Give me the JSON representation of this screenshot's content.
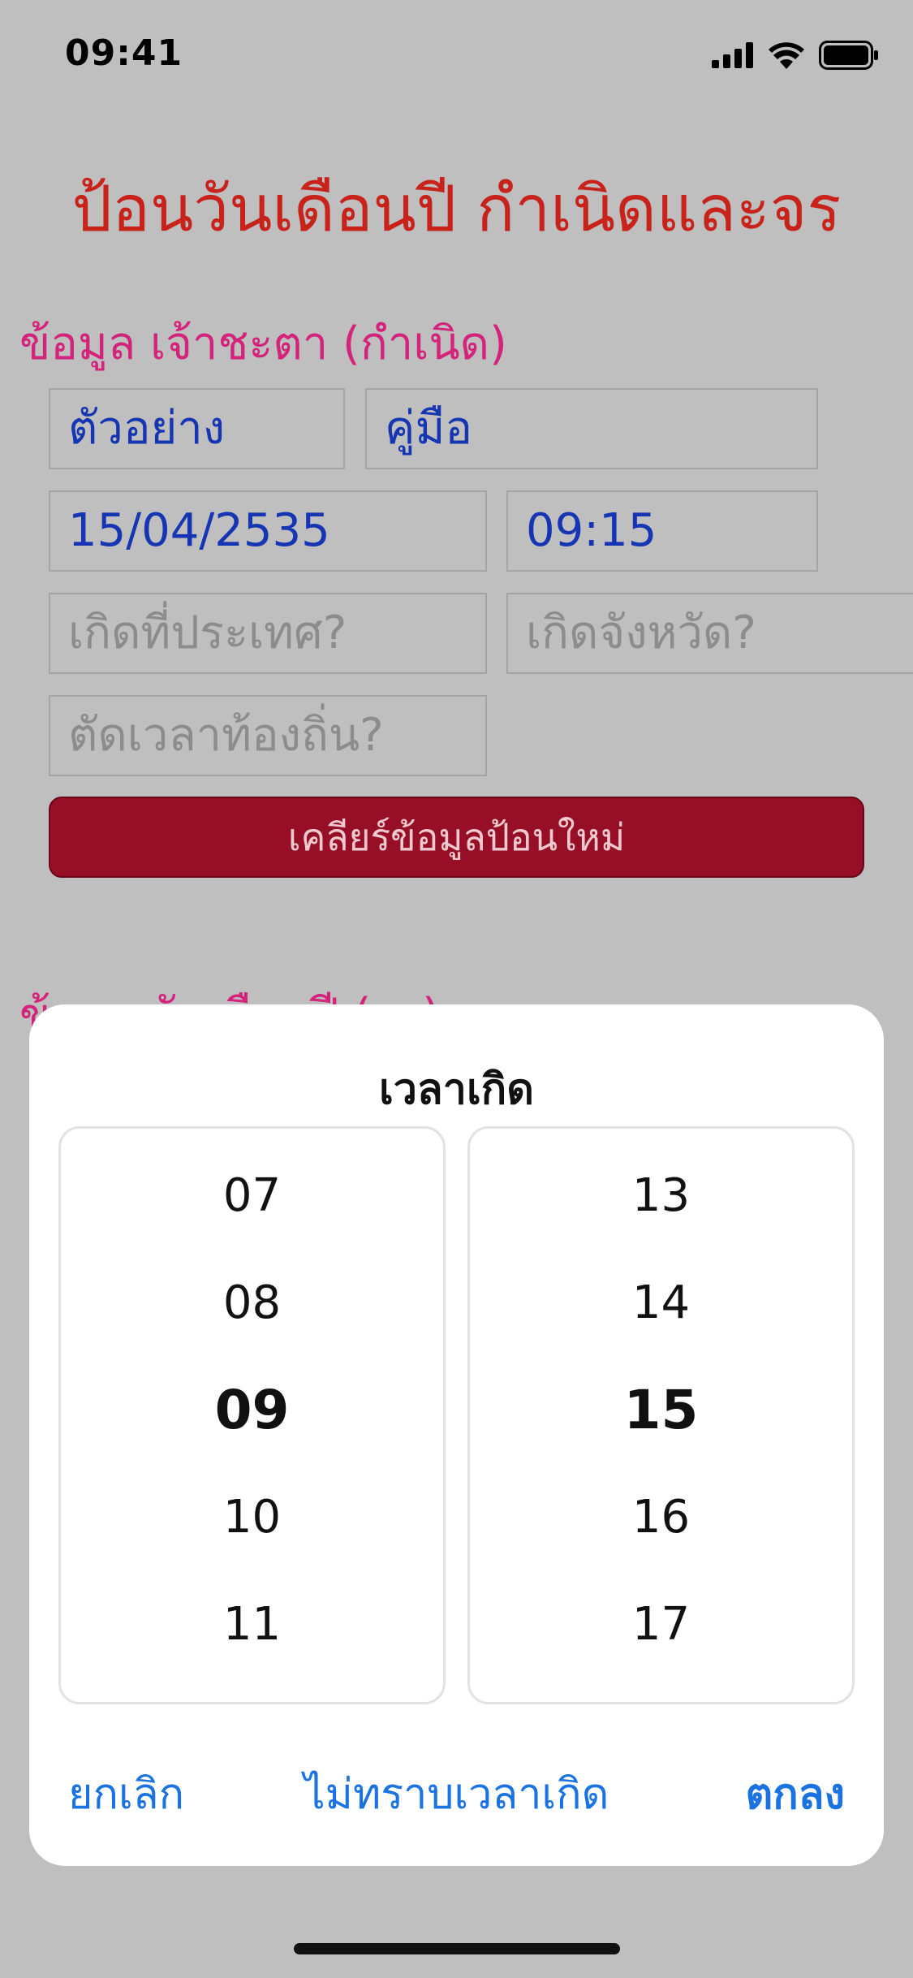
{
  "status_bar": {
    "time": "09:41"
  },
  "page": {
    "title": "ป้อนวันเดือนปี กำเนิดและจร"
  },
  "birth_section": {
    "title": "ข้อมูล เจ้าชะตา (กำเนิด)",
    "first_name": "ตัวอย่าง",
    "last_name": "คู่มือ",
    "date": "15/04/2535",
    "time": "09:15",
    "country_placeholder": "เกิดที่ประเทศ?",
    "province_placeholder": "เกิดจังหวัด?",
    "local_time_placeholder": "ตัดเวลาท้องถิ่น?",
    "clear_button": "เคลียร์ข้อมูลป้อนใหม่"
  },
  "transit_section": {
    "title": "ข้อมูล วันเดือนปี (จร)"
  },
  "time_picker": {
    "title": "เวลาเกิด",
    "hours": [
      "07",
      "08",
      "09",
      "10",
      "11"
    ],
    "minutes": [
      "13",
      "14",
      "15",
      "16",
      "17"
    ],
    "selected_hour": "09",
    "selected_minute": "15",
    "cancel_button": "ยกเลิก",
    "unknown_time_button": "ไม่ทราบเวลาเกิด",
    "ok_button": "ตกลง"
  },
  "colors": {
    "title_red": "#c8231b",
    "section_pink": "#d3237b",
    "value_blue": "#1535b3",
    "clear_button_bg": "#970e27",
    "action_blue": "#1a73e0"
  }
}
